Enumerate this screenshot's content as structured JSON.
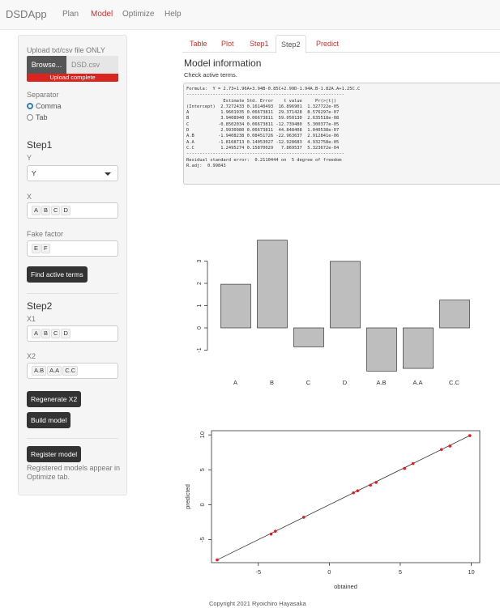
{
  "navbar": {
    "brand": "DSDApp",
    "links": [
      "Plan",
      "Model",
      "Optimize",
      "Help"
    ]
  },
  "sidebar": {
    "upload_label": "Upload txt/csv file ONLY",
    "browse_label": "Browse...",
    "file_name": "DSD.csv",
    "upload_status": "Upload complete",
    "separator_label": "Separator",
    "separator_options": [
      "Comma",
      "Tab"
    ],
    "step1_title": "Step1",
    "y_label": "Y",
    "y_value": "Y",
    "x_label": "X",
    "x_chips": [
      "A",
      "B",
      "C",
      "D"
    ],
    "fake_label": "Fake factor",
    "fake_chips": [
      "E",
      "F"
    ],
    "find_button": "Find active terms",
    "step2_title": "Step2",
    "x1_label": "X1",
    "x1_chips": [
      "A",
      "B",
      "C",
      "D"
    ],
    "x2_label": "X2",
    "x2_chips": [
      "A.B",
      "A.A",
      "C.C"
    ],
    "regen_button": "Regenerate X2",
    "build_button": "Build model",
    "register_button": "Register model",
    "register_note": "Registered models appear in Optimize tab."
  },
  "tabs": [
    "Table",
    "Plot",
    "Step1",
    "Step2",
    "Predict"
  ],
  "main": {
    "title": "Model information",
    "subtitle": "Check active terms.",
    "code_lines": [
      "Formula:  Y = 2.73+1.96A+3.94B-0.85C+2.99D-1.94A.B-1.82A.A+1.25C.C",
      "------------------------------------------------------------",
      "              Estimate Std. Error    t value     Pr(>|t|)",
      "(Intercept)  2.7272433 0.16140493  16.896901  1.327722e-05",
      "A            1.9601935 0.06673811  29.371428  8.576297e-07",
      "B            3.9408940 0.06673811  59.050130  2.635518e-08",
      "C           -0.8502034 0.06673811 -12.739480  5.300377e-05",
      "D            2.9930980 0.06673811  44.848408  1.040538e-07",
      "A.B         -1.9408238 0.08451726 -22.963637  2.912841e-06",
      "A.A         -1.8168713 0.14053027 -12.928683  4.932758e-05",
      "C.C          1.2495274 0.15870029   7.869537  5.323672e-04",
      "------------------------------------------------------------",
      "Residual standard error:  0.2110444 on  5 degree of freedom",
      "R.adj:  0.99843"
    ],
    "footer": "Copyright 2021 Ryoichiro Hayasaka"
  },
  "chart_data": [
    {
      "type": "bar",
      "categories": [
        "A",
        "B",
        "C",
        "D",
        "A.B",
        "A.A",
        "C.C"
      ],
      "values": [
        1.96,
        3.94,
        -0.85,
        2.99,
        -1.94,
        -1.82,
        1.25
      ],
      "yticks": [
        -1,
        0,
        1,
        2,
        3
      ],
      "ylim": [
        -2,
        4
      ]
    },
    {
      "type": "scatter",
      "xlabel": "obtained",
      "ylabel": "predicted",
      "xticks": [
        -5,
        0,
        5,
        10
      ],
      "yticks": [
        -5,
        0,
        5,
        10
      ],
      "xlim": [
        -8.3,
        10.6
      ],
      "ylim": [
        -8.3,
        10.6
      ],
      "points": [
        [
          -7.9,
          -7.9
        ],
        [
          -4.1,
          -4.2
        ],
        [
          -3.8,
          -3.8
        ],
        [
          -1.8,
          -1.8
        ],
        [
          1.7,
          1.7
        ],
        [
          2.0,
          2.0
        ],
        [
          2.9,
          2.8
        ],
        [
          3.3,
          3.2
        ],
        [
          5.3,
          5.2
        ],
        [
          5.9,
          5.9
        ],
        [
          7.9,
          7.9
        ],
        [
          8.5,
          8.4
        ],
        [
          9.9,
          9.9
        ]
      ],
      "line": [
        [
          -7.9,
          -7.9
        ],
        [
          9.9,
          9.9
        ]
      ],
      "point_color": "#e41a1c"
    }
  ]
}
